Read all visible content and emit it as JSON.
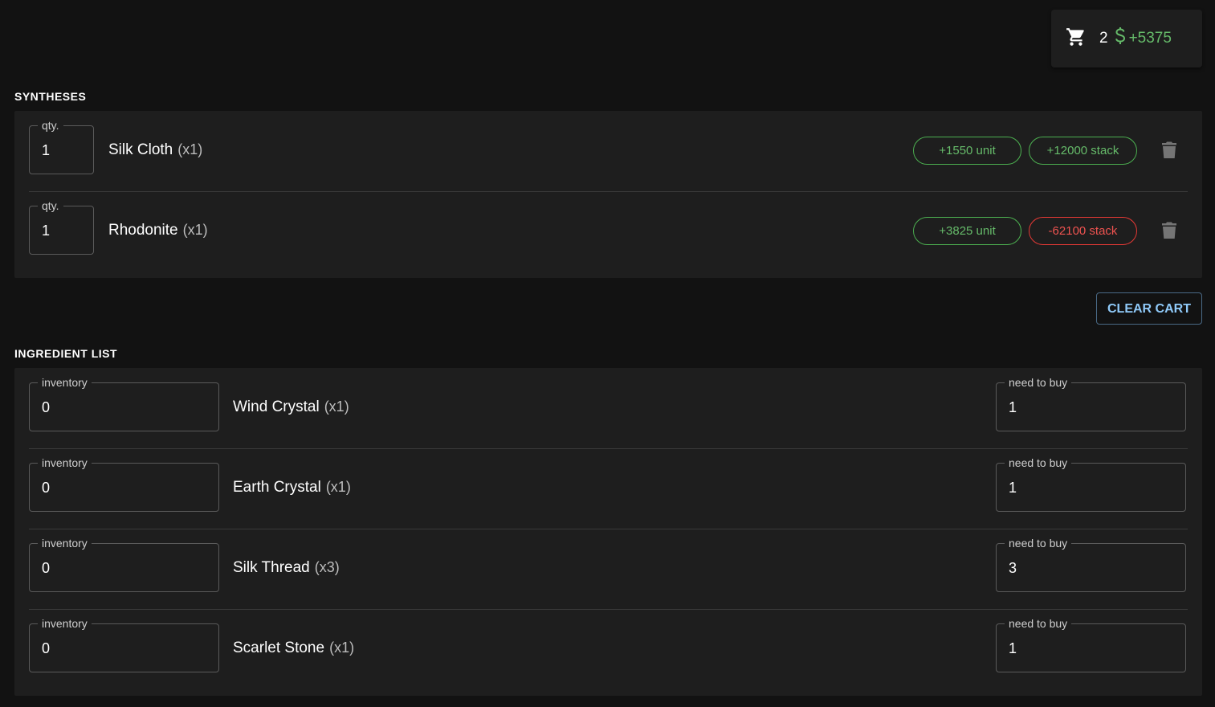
{
  "summary": {
    "cart_count": "2",
    "profit": "+5375"
  },
  "syntheses": {
    "title": "SYNTHESES",
    "qty_label": "qty.",
    "items": [
      {
        "qty": "1",
        "name": "Silk Cloth",
        "mult": "(x1)",
        "unit": "+1550 unit",
        "stack": "+12000 stack",
        "stack_status": "positive"
      },
      {
        "qty": "1",
        "name": "Rhodonite",
        "mult": "(x1)",
        "unit": "+3825 unit",
        "stack": "-62100 stack",
        "stack_status": "negative"
      }
    ]
  },
  "clear_cart_label": "CLEAR CART",
  "ingredients": {
    "title": "INGREDIENT LIST",
    "inventory_label": "inventory",
    "need_label": "need to buy",
    "items": [
      {
        "inventory": "0",
        "name": "Wind Crystal",
        "mult": "(x1)",
        "need": "1"
      },
      {
        "inventory": "0",
        "name": "Earth Crystal",
        "mult": "(x1)",
        "need": "1"
      },
      {
        "inventory": "0",
        "name": "Silk Thread",
        "mult": "(x3)",
        "need": "3"
      },
      {
        "inventory": "0",
        "name": "Scarlet Stone",
        "mult": "(x1)",
        "need": "1"
      }
    ]
  },
  "colors": {
    "positive": "#66bb6a",
    "negative": "#ef5350",
    "accent": "#90caf9"
  }
}
